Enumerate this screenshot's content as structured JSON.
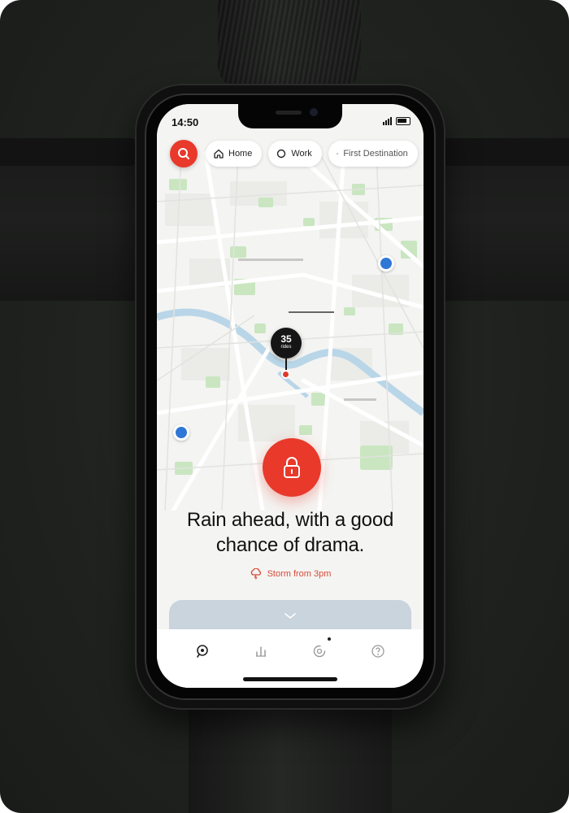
{
  "status_bar": {
    "time": "14:50"
  },
  "search": {
    "icon": "search-icon"
  },
  "chips": [
    {
      "label": "Home",
      "icon": "home-icon"
    },
    {
      "label": "Work",
      "icon": "work-icon"
    },
    {
      "label": "First Destination",
      "icon": "star-icon"
    }
  ],
  "map": {
    "cluster": {
      "count": "35",
      "unit": "rides"
    }
  },
  "unlock": {
    "icon": "unlock-icon"
  },
  "message": {
    "headline_line1": "Rain ahead, with a good",
    "headline_line2": "chance of drama."
  },
  "weather": {
    "text": "Storm from 3pm",
    "icon": "storm-cloud-icon"
  },
  "sheet": {
    "icon": "chevron-down-icon"
  },
  "tabs": [
    {
      "name": "map",
      "icon": "map-pin-icon"
    },
    {
      "name": "stats",
      "icon": "stats-icon"
    },
    {
      "name": "rides",
      "icon": "rides-icon",
      "has_indicator": true
    },
    {
      "name": "help",
      "icon": "help-icon"
    }
  ],
  "colors": {
    "accent": "#e8392b",
    "scooter_marker": "#2f77d6",
    "map_background": "#f4f4f2",
    "park": "#c9e6c0",
    "water": "#b9d6e8"
  }
}
